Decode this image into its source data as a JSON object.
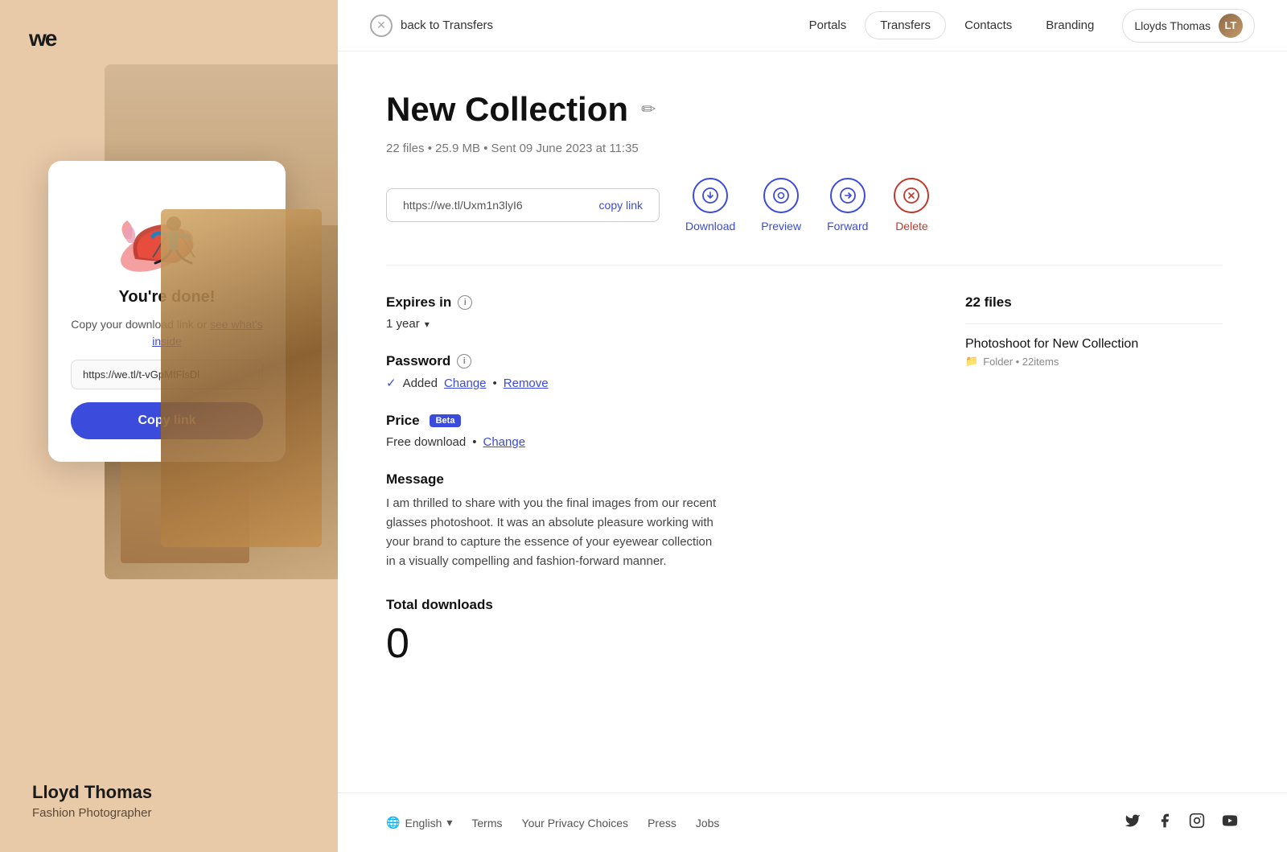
{
  "logo": "we",
  "left_panel": {
    "user_name": "Lloyd Thomas",
    "user_title": "Fashion Photographer"
  },
  "modal": {
    "title": "You're done!",
    "subtitle_before_link": "Copy your download link or ",
    "subtitle_link": "see what's inside",
    "link_value": "https://we.tl/t-vGpMfFlsDl",
    "copy_button_label": "Copy link"
  },
  "nav": {
    "back_label": "back to Transfers",
    "links": [
      "Portals",
      "Transfers",
      "Contacts",
      "Branding"
    ],
    "user_name": "Lloyds Thomas"
  },
  "main": {
    "title": "New Collection",
    "meta": "22 files  •  25.9 MB  •  Sent 09 June 2023 at 11:35",
    "link": "https://we.tl/Uxm1n3lyI6",
    "copy_link_label": "copy link",
    "actions": {
      "download": "Download",
      "preview": "Preview",
      "forward": "Forward",
      "delete": "Delete"
    },
    "expires_label": "Expires in",
    "expires_value": "1 year",
    "password_label": "Password",
    "password_added": "Added",
    "password_change": "Change",
    "password_remove": "Remove",
    "price_label": "Price",
    "price_badge": "Beta",
    "price_value": "Free download",
    "price_change": "Change",
    "message_label": "Message",
    "message_text": "I am thrilled to share with you the final images from our recent glasses photoshoot. It was an absolute pleasure working with your brand to capture the essence of your eyewear collection in a visually compelling and fashion-forward manner.",
    "downloads_label": "Total downloads",
    "downloads_count": "0",
    "files_count_label": "22 files",
    "folder_name": "Photoshoot for New Collection",
    "folder_meta": "Folder  •  22items"
  },
  "footer": {
    "lang": "English",
    "links": [
      "Terms",
      "Your Privacy Choices",
      "Press",
      "Jobs"
    ],
    "socials": [
      "twitter",
      "facebook",
      "instagram",
      "youtube"
    ]
  }
}
